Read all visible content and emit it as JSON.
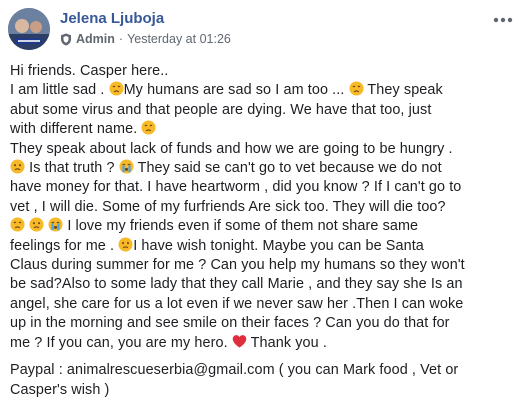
{
  "post": {
    "author": "Jelena Ljuboja",
    "role": "Admin",
    "separator": "·",
    "timestamp": "Yesterday at 01:26",
    "more_glyph": "•••",
    "paypal": "Paypal : animalrescueserbia@gmail.com ( you can Mark food , Vet or",
    "paypal_2": "Casper's wish )"
  },
  "colors": {
    "author_link": "#385898",
    "meta_text": "#606770",
    "body_text": "#1c1e21",
    "emoji_face": "#f7b928",
    "heart": "#e02e3d"
  },
  "icons": {
    "role": "shield-icon",
    "more": "more-options-icon",
    "sad": "sad-face-emoji",
    "worried": "worried-face-emoji",
    "crying": "crying-face-emoji",
    "disappointed": "disappointed-face-emoji",
    "heart": "red-heart-emoji"
  },
  "text": {
    "l1": "Hi friends. Casper here..",
    "l2a": "I am little sad .",
    "l2b": "My humans are sad so I am too ...",
    "l2c": "They speak",
    "l3": "abut some virus and that people are dying. We have that too, just",
    "l4": "with different name.",
    "l5": "They speak about lack of funds and how we are going to be hungry .",
    "l6a": "Is that truth ?",
    "l6b": "They said se can't go to vet because we do not",
    "l7": "have money for that. I have heartworm , did you know ? If I can't go to",
    "l8": "vet , I will die. Some of my furfriends Are sick too. They will die too?",
    "l9": "I love my friends even if some of them not share same",
    "l10a": "feelings for me .",
    "l10b": "I have wish tonight. Maybe you can be Santa",
    "l11": "Claus during summer for me ? Can you help my humans so they won't",
    "l12": "be sad?Also to some lady that they call Marie , and they say she Is an",
    "l13": "angel, she care for us a lot even if we never saw her .Then I can woke",
    "l14": "up in the morning and see smile on their faces ? Can you do that for",
    "l15a": "me ? If you can, you are my hero.",
    "l15b": "Thank you ."
  }
}
